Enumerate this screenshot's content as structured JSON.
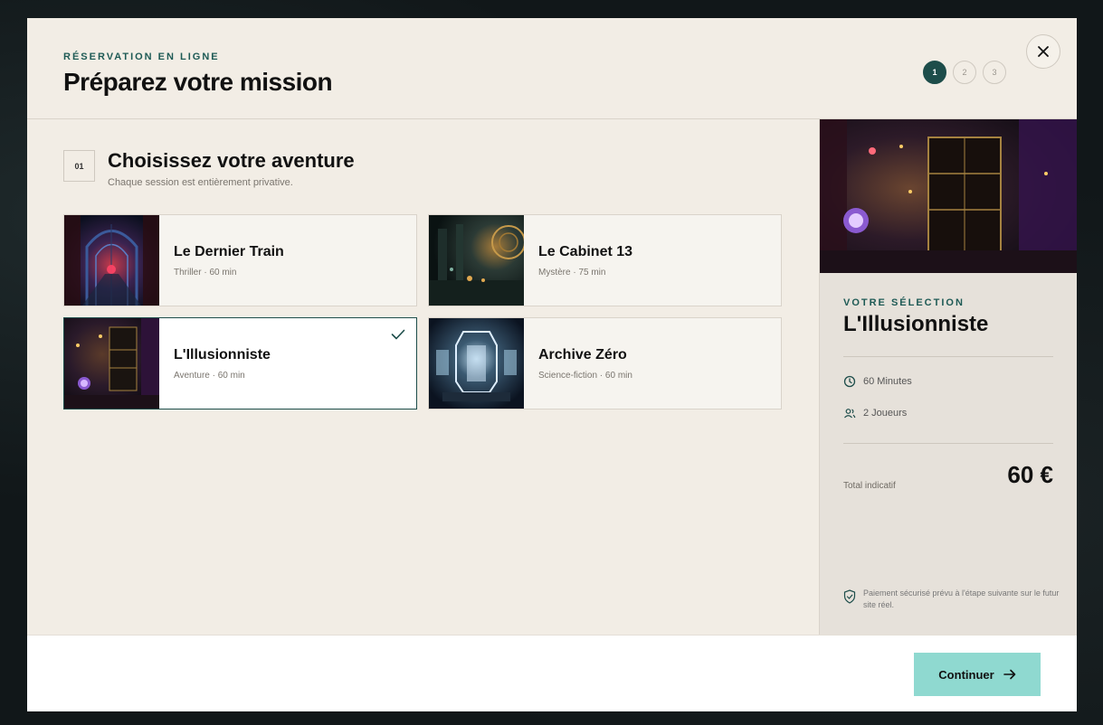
{
  "header": {
    "eyebrow": "RÉSERVATION EN LIGNE",
    "title": "Préparez votre mission",
    "steps": [
      "1",
      "2",
      "3"
    ],
    "active_step": 1
  },
  "section": {
    "number": "01",
    "title": "Choisissez votre aventure",
    "subtitle": "Chaque session est entièrement privative."
  },
  "adventures": [
    {
      "name": "Le Dernier Train",
      "meta": "Thriller · 60 min",
      "selected": false,
      "thumb": "train-scene"
    },
    {
      "name": "Le Cabinet 13",
      "meta": "Mystère · 75 min",
      "selected": false,
      "thumb": "cabinet-scene"
    },
    {
      "name": "L'Illusionniste",
      "meta": "Aventure · 60 min",
      "selected": true,
      "thumb": "magic-scene"
    },
    {
      "name": "Archive Zéro",
      "meta": "Science-fiction · 60 min",
      "selected": false,
      "thumb": "scifi-scene"
    }
  ],
  "selection": {
    "eyebrow": "VOTRE SÉLECTION",
    "title": "L'Illusionniste",
    "duration": "60 Minutes",
    "players": "2 Joueurs",
    "total_label": "Total indicatif",
    "total_price": "60 €",
    "secure_note": "Paiement sécurisé prévu à l'étape suivante sur le futur site réel."
  },
  "footer": {
    "continue_label": "Continuer"
  },
  "colors": {
    "accent": "#1d4d4a",
    "button": "#8fd9d0",
    "background": "#f2ede5",
    "sidebar": "#e6e1da"
  }
}
